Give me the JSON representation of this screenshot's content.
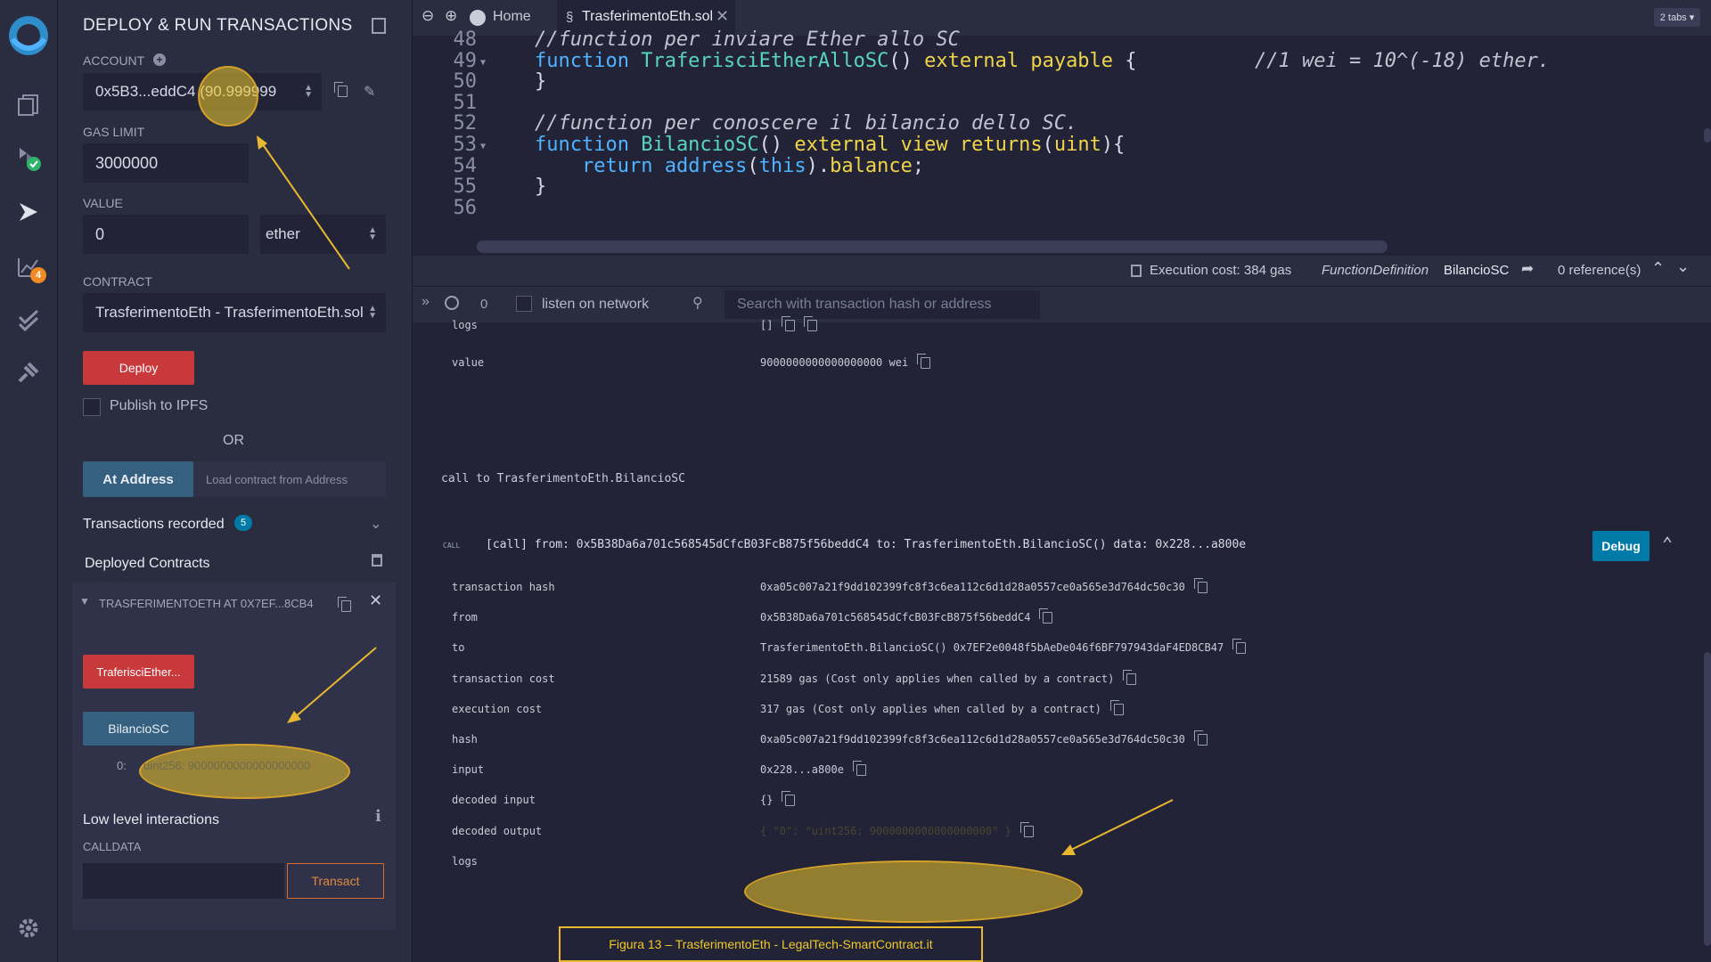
{
  "sidebar": {
    "title": "DEPLOY & RUN TRANSACTIONS",
    "account_label": "ACCOUNT",
    "account_value": "0x5B3...eddC4 (90.999999",
    "gas_limit_label": "GAS LIMIT",
    "gas_limit_value": "3000000",
    "value_label": "VALUE",
    "value_amount": "0",
    "value_unit": "ether",
    "contract_label": "CONTRACT",
    "contract_value": "TrasferimentoEth - TrasferimentoEth.sol",
    "deploy_label": "Deploy",
    "publish_label": "Publish to IPFS",
    "or_label": "OR",
    "at_address_label": "At Address",
    "load_placeholder": "Load contract from Address",
    "tx_recorded_label": "Transactions recorded",
    "tx_recorded_count": "5",
    "deployed_label": "Deployed Contracts",
    "instance_label": "TRASFERIMENTOETH AT 0X7EF...8CB4",
    "fn1_label": "TraferisciEther...",
    "fn2_label": "BilancioSC",
    "result_index": "0:",
    "result_value": "uint256: 9000000000000000000",
    "low_level_label": "Low level interactions",
    "calldata_label": "CALLDATA",
    "transact_label": "Transact"
  },
  "tabs": {
    "home_label": "Home",
    "file_label": "TrasferimentoEth.sol",
    "tabs_count": "2 tabs"
  },
  "editor": {
    "lines": [
      {
        "n": "48",
        "text": "    //function per inviare Ether allo SC"
      },
      {
        "n": "49",
        "text": "    function TraferisciEtherAlloSC() external payable {          //1 wei = 10^(-18) ether."
      },
      {
        "n": "50",
        "text": "    }"
      },
      {
        "n": "51",
        "text": ""
      },
      {
        "n": "52",
        "text": "    //function per conoscere il bilancio dello SC."
      },
      {
        "n": "53",
        "text": "    function BilancioSC() external view returns(uint){"
      },
      {
        "n": "54",
        "text": "        return address(this).balance;"
      },
      {
        "n": "55",
        "text": "    }"
      },
      {
        "n": "56",
        "text": ""
      }
    ],
    "exec_cost": "Execution cost: 384 gas",
    "fn_def_type": "FunctionDefinition",
    "fn_def_name": "BilancioSC",
    "references": "0 reference(s)"
  },
  "terminal": {
    "pending_count": "0",
    "listen_label": "listen on network",
    "search_placeholder": "Search with transaction hash or address",
    "prev_logs_key": "logs",
    "prev_logs_val": "[]",
    "prev_value_key": "value",
    "prev_value_val": "9000000000000000000 wei",
    "call_header": "call to TrasferimentoEth.BilancioSC",
    "call_tag": "CALL",
    "call_line": "[call] from: 0x5B38Da6a701c568545dCfcB03FcB875f56beddC4 to: TrasferimentoEth.BilancioSC() data: 0x228...a800e",
    "debug_label": "Debug",
    "rows": [
      {
        "k": "transaction hash",
        "v": "0xa05c007a21f9dd102399fc8f3c6ea112c6d1d28a0557ce0a565e3d764dc50c30"
      },
      {
        "k": "from",
        "v": "0x5B38Da6a701c568545dCfcB03FcB875f56beddC4"
      },
      {
        "k": "to",
        "v": "TrasferimentoEth.BilancioSC() 0x7EF2e0048f5bAeDe046f6BF797943daF4ED8CB47"
      },
      {
        "k": "transaction cost",
        "v": "21589 gas (Cost only applies when called by a contract)"
      },
      {
        "k": "execution cost",
        "v": "317 gas (Cost only applies when called by a contract)"
      },
      {
        "k": "hash",
        "v": "0xa05c007a21f9dd102399fc8f3c6ea112c6d1d28a0557ce0a565e3d764dc50c30"
      },
      {
        "k": "input",
        "v": "0x228...a800e"
      },
      {
        "k": "decoded input",
        "v": "{}"
      },
      {
        "k": "decoded output",
        "v": "{ \"0\": \"uint256: 9000000000000000000\" }"
      },
      {
        "k": "logs",
        "v": ""
      }
    ]
  },
  "caption": "Figura 13 – TrasferimentoEth - LegalTech-SmartContract.it",
  "colors": {
    "accent_yellow": "#f0c828",
    "deploy_red": "#c8393c",
    "call_blue": "#35607f",
    "debug_blue": "#007aa6"
  }
}
